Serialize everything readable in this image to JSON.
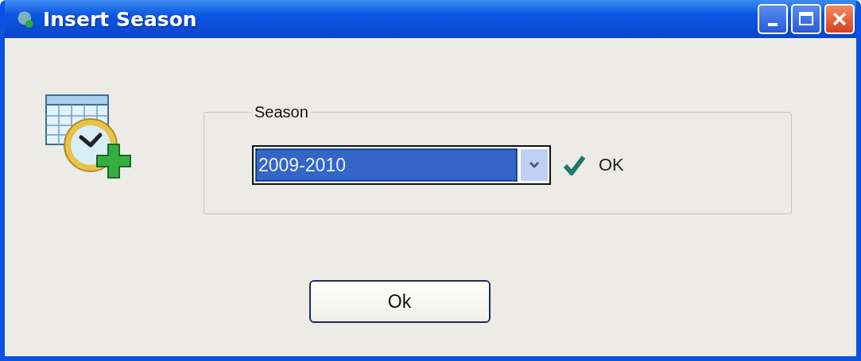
{
  "window": {
    "title": "Insert Season"
  },
  "season_group": {
    "legend": "Season",
    "combo": {
      "value": "2009-2010"
    },
    "checkbox": {
      "label": "OK",
      "checked": true
    }
  },
  "buttons": [
    {
      "label": "Ok"
    }
  ]
}
